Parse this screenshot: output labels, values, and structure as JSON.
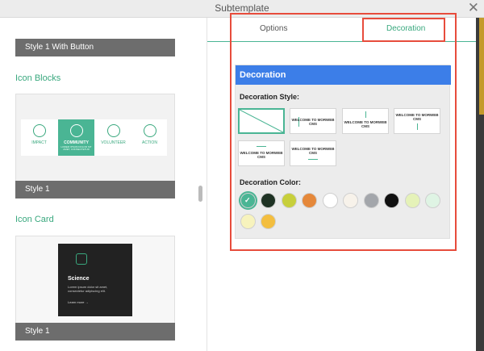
{
  "window": {
    "title": "Subtemplate",
    "close_icon": "close-icon"
  },
  "left_panel": {
    "card1_footer": "Style 1 With Button",
    "icon_blocks": {
      "title": "Icon Blocks",
      "items": [
        {
          "label": "IMPACT",
          "icon": "hands-icon"
        },
        {
          "label": "COMMUNITY",
          "icon": "people-icon",
          "active": true,
          "sub": "LOREM IPSUM DOLOR SIT AMET, CONSECTETUR"
        },
        {
          "label": "VOLUNTEER",
          "icon": "group-icon"
        },
        {
          "label": "ACTION",
          "icon": "hand-heart-icon"
        }
      ],
      "footer": "Style 1"
    },
    "icon_card": {
      "title": "Icon Card",
      "card_heading": "Science",
      "card_text": "Lorem ipsum dolor sit amet, consectetur adipiscing elit.",
      "card_link": "Learn more →",
      "footer": "Style 1"
    }
  },
  "tabs": {
    "options": "Options",
    "decoration": "Decoration",
    "active": "decoration"
  },
  "decoration": {
    "header": "Decoration",
    "style_label": "Decoration Style:",
    "style_text": "WELCOME TO MORWEB CMS",
    "color_label": "Decoration Color:",
    "colors": [
      "#4ab594",
      "#1f3324",
      "#c7cf3b",
      "#e5883a",
      "#ffffff",
      "#f7f2ea",
      "#a3a6ab",
      "#111111",
      "#e5f2b8",
      "#dff4e4",
      "#f7f3bd",
      "#f3be3f"
    ],
    "selected_color_index": 0,
    "accent": "#4ab594",
    "header_color": "#3c7ee8",
    "highlight_color": "#e74c3c"
  }
}
